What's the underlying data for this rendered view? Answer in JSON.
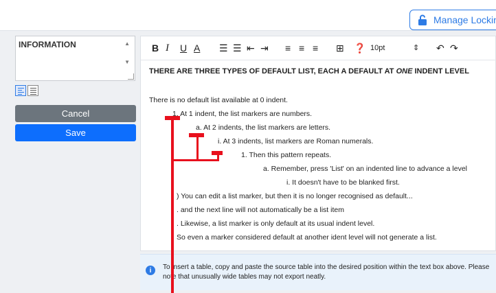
{
  "header": {
    "lock_button_label": "Manage Locking"
  },
  "sidebar": {
    "info_label": "INFORMATION",
    "cancel_label": "Cancel",
    "save_label": "Save"
  },
  "toolbar": {
    "bold": "B",
    "italic": "I",
    "underline": "U",
    "font_color": "A",
    "font_size": "10pt"
  },
  "editor": {
    "heading_pre": "THERE ARE THREE TYPES OF DEFAULT LIST, EACH A DEFAULT AT",
    "heading_em": "ONE",
    "heading_post": "INDENT LEVEL",
    "lines": [
      "There is no default list available at 0 indent.",
      "1. At 1 indent, the list markers are numbers.",
      "a. At 2 indents, the list markers are letters.",
      "i. At 3 indents, list markers are Roman numerals.",
      "1. Then this pattern repeats.",
      "a. Remember, press 'List' on an indented line to advance a level",
      "i. It doesn't have to be blanked first.",
      ") You can edit a list marker, but then it is no longer recognised as default...",
      ". and the next line will not automatically be a list item",
      ". Likewise, a list marker is only default at its usual indent level.",
      "So even a marker considered default at another ident level will not generate a list."
    ]
  },
  "note": {
    "text": "To insert a table, copy and paste the source table into the desired position within the text box above. Please note that unusually wide tables may not export neatly."
  },
  "colors": {
    "accent": "#2d7be5",
    "save": "#0d6efd",
    "cancel": "#6c757d",
    "annotation": "#e8101d"
  }
}
